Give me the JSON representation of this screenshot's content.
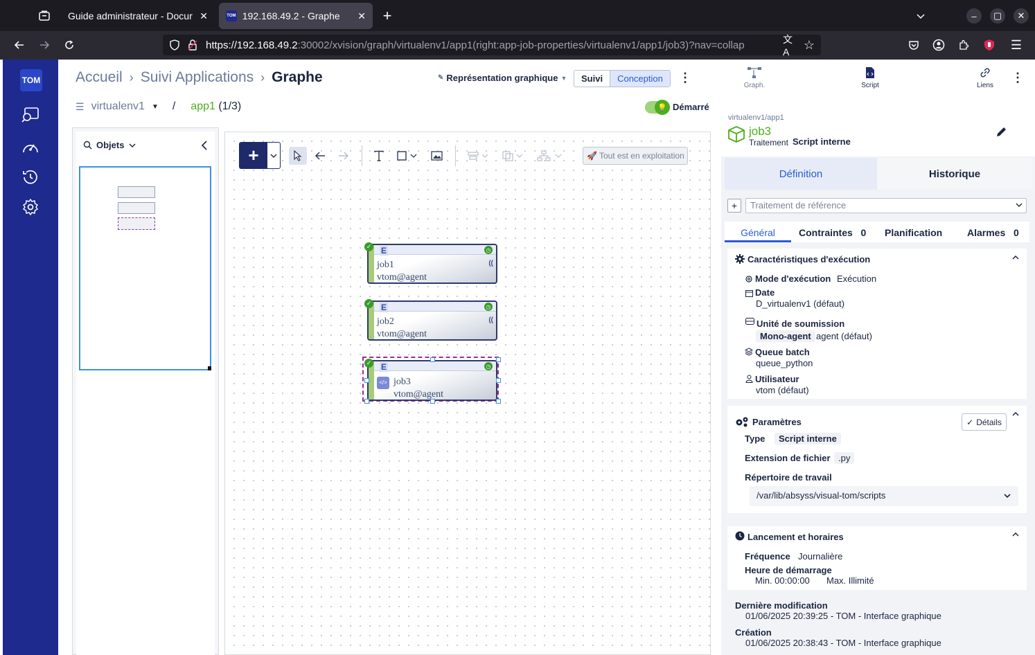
{
  "browser": {
    "tabs": [
      {
        "title": "Guide administrateur - Docur"
      },
      {
        "title": "192.168.49.2 - Graphe",
        "favicon": "TOM"
      }
    ],
    "url_host": "https://192.168.49.2",
    "url_rest": ":30002/xvision/graph/virtualenv1/app1(right:app-job-properties/virtualenv1/app1/job3)?nav=collap"
  },
  "app": {
    "logo": "TOM",
    "breadcrumb": [
      "Accueil",
      "Suivi Applications",
      "Graphe"
    ],
    "representation": "Représentation graphique",
    "mode_buttons": [
      "Suivi",
      "Conception"
    ],
    "environment": "virtualenv1",
    "separator": "/",
    "application": "app1",
    "app_count": "(1/3)",
    "status_label": "Démarré",
    "objects_label": "Objets",
    "exploitation_button": "Tout est en exploitation"
  },
  "jobs": [
    {
      "badge": "E",
      "name": "job1",
      "agent": "vtom@agent",
      "selected": false
    },
    {
      "badge": "E",
      "name": "job2",
      "agent": "vtom@agent",
      "selected": false
    },
    {
      "badge": "E",
      "name": "job3",
      "agent": "vtom@agent",
      "selected": true
    }
  ],
  "panel": {
    "top_tabs": [
      "Graph.",
      "Script",
      "Liens"
    ],
    "path": "virtualenv1/app1",
    "job_name": "job3",
    "job_type_label": "Traitement",
    "job_type_value": "Script interne",
    "main_tabs": [
      "Définition",
      "Historique"
    ],
    "reference_placeholder": "Traitement de référence",
    "sub_tabs": [
      {
        "label": "Général",
        "count": ""
      },
      {
        "label": "Contraintes",
        "count": "0"
      },
      {
        "label": "Planification",
        "count": ""
      },
      {
        "label": "Alarmes",
        "count": "0"
      }
    ],
    "exec": {
      "title": "Caractéristiques d'exécution",
      "mode_label": "Mode d'exécution",
      "mode_value": "Exécution",
      "date_label": "Date",
      "date_value": "D_virtualenv1 (défaut)",
      "unit_label": "Unité de soumission",
      "unit_chip": "Mono-agent",
      "unit_value": "agent (défaut)",
      "queue_label": "Queue batch",
      "queue_value": "queue_python",
      "user_label": "Utilisateur",
      "user_value": "vtom (défaut)"
    },
    "params": {
      "title": "Paramètres",
      "details_button": "Détails",
      "type_label": "Type",
      "type_value": "Script interne",
      "ext_label": "Extension de fichier",
      "ext_value": ".py",
      "dir_label": "Répertoire de travail",
      "dir_value": "/var/lib/absyss/visual-tom/scripts"
    },
    "launch": {
      "title": "Lancement et horaires",
      "freq_label": "Fréquence",
      "freq_value": "Journalière",
      "start_label": "Heure de démarrage",
      "min": "Min. 00:00:00",
      "max": "Max. Illimité"
    },
    "last_mod_label": "Dernière modification",
    "last_mod_value": "01/06/2025 20:39:25 - TOM - Interface graphique",
    "created_label": "Création",
    "created_value": "01/06/2025 20:38:43 - TOM - Interface graphique"
  },
  "colors": {
    "sidebar": "#1e2a8e",
    "accent": "#2a5bd7",
    "green": "#4caf1e"
  }
}
